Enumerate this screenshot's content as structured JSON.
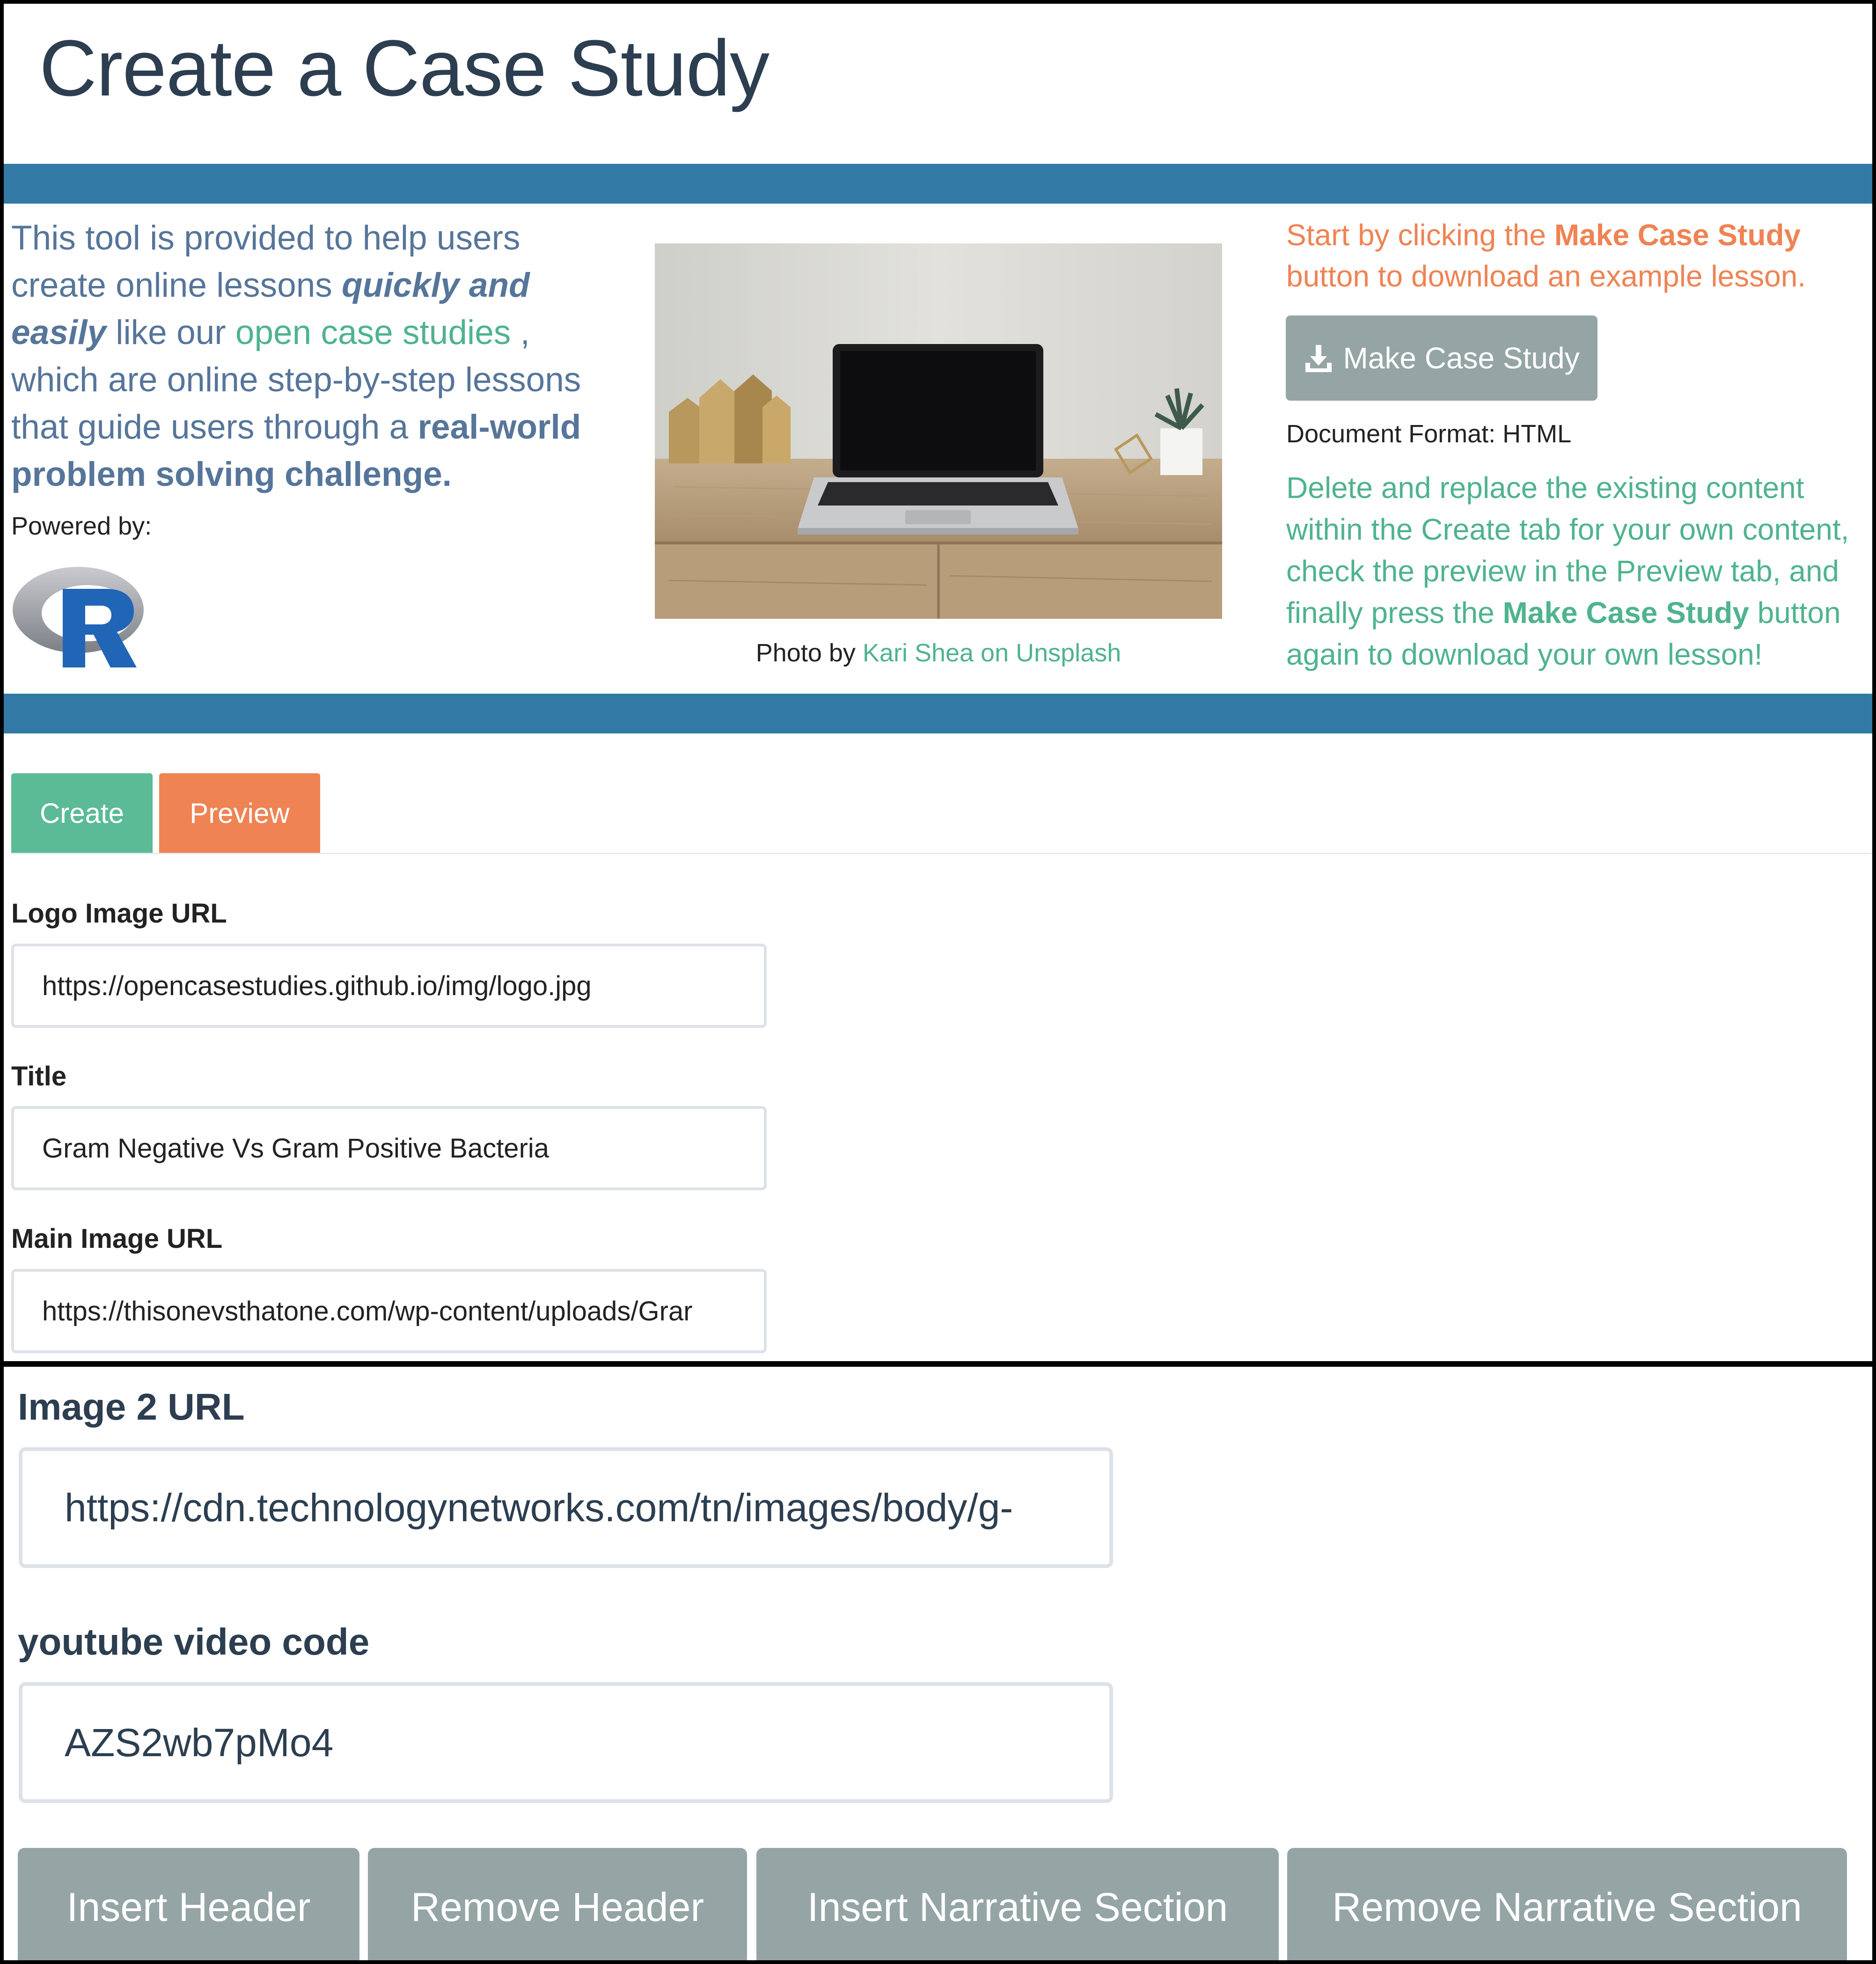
{
  "header": {
    "title": "Create a Case Study"
  },
  "intro": {
    "part1": "This tool is provided to help users create online lessons ",
    "emphasis": "quickly and easily",
    "part2": " like our ",
    "link": "open case studies",
    "part3": " , which are online step-by-step lessons that guide users through a ",
    "bold": "real-world problem solving challenge."
  },
  "powered_by": {
    "label": "Powered by:",
    "logo": "r-logo"
  },
  "photo": {
    "caption_prefix": "Photo by ",
    "caption_link": "Kari Shea on Unsplash"
  },
  "instructions": {
    "start_prefix": "Start by clicking the ",
    "start_bold": "Make Case Study",
    "start_suffix": " button to download an example lesson.",
    "make_button": {
      "label": "Make Case Study",
      "icon": "download-icon"
    },
    "document_format": "Document Format: HTML",
    "replace_prefix": "Delete and replace the existing content within the Create tab for your own content, check the preview in the Preview tab, and finally press the ",
    "replace_bold": "Make Case Study",
    "replace_suffix": " button again to download your own lesson!"
  },
  "tabs": [
    {
      "label": "Create"
    },
    {
      "label": "Preview"
    }
  ],
  "form": {
    "logo_url": {
      "label": "Logo Image URL",
      "value": "https://opencasestudies.github.io/img/logo.jpg"
    },
    "title": {
      "label": "Title",
      "value": "Gram Negative Vs Gram Positive Bacteria"
    },
    "main_image_url": {
      "label": "Main Image URL",
      "value": "https://thisonevsthatone.com/wp-content/uploads/Grar"
    },
    "image2_url": {
      "label": "Image 2 URL",
      "value": "https://cdn.technologynetworks.com/tn/images/body/g-"
    },
    "youtube_code": {
      "label": "youtube video code",
      "value": "AZS2wb7pMo4"
    }
  },
  "actions": {
    "insert_header": "Insert Header",
    "remove_header": "Remove Header",
    "insert_narrative": "Insert Narrative Section",
    "remove_narrative": "Remove Narrative Section"
  },
  "colors": {
    "band": "#3279a6",
    "accent_green": "#4fb38f",
    "accent_orange": "#ef8354",
    "button_gray": "#95a5a6",
    "title_text": "#2c3e50"
  }
}
